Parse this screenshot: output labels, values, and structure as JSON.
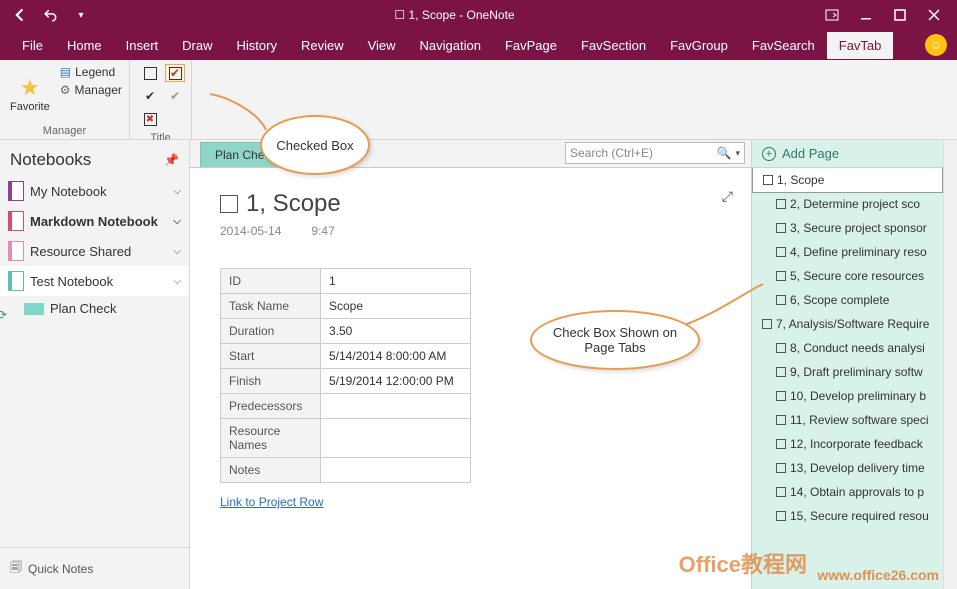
{
  "window": {
    "title": "☐ 1, Scope  -  OneNote"
  },
  "menu": {
    "items": [
      "File",
      "Home",
      "Insert",
      "Draw",
      "History",
      "Review",
      "View",
      "Navigation",
      "FavPage",
      "FavSection",
      "FavGroup",
      "FavSearch",
      "FavTab"
    ],
    "active": 12
  },
  "ribbon": {
    "favorite_label": "Favorite",
    "legend_label": "Legend",
    "manager_label": "Manager",
    "group1": "Manager",
    "group2": "Title"
  },
  "sidebar": {
    "title": "Notebooks",
    "items": [
      {
        "label": "My Notebook",
        "color": "purple"
      },
      {
        "label": "Markdown Notebook",
        "color": "red",
        "bold": true
      },
      {
        "label": "Resource Shared",
        "color": "pink"
      },
      {
        "label": "Test Notebook",
        "color": "teal",
        "selected": true
      }
    ],
    "section": "Plan Check",
    "quick": "Quick Notes"
  },
  "tabs": {
    "active": "Plan Check"
  },
  "search": {
    "placeholder": "Search (Ctrl+E)"
  },
  "page": {
    "title": "1, Scope",
    "date": "2014-05-14",
    "time": "9:47",
    "link": "Link to Project Row"
  },
  "table": [
    {
      "k": "ID",
      "v": "1"
    },
    {
      "k": "Task Name",
      "v": "Scope"
    },
    {
      "k": "Duration",
      "v": "3.50"
    },
    {
      "k": "Start",
      "v": "5/14/2014 8:00:00 AM"
    },
    {
      "k": "Finish",
      "v": "5/19/2014 12:00:00 PM"
    },
    {
      "k": "Predecessors",
      "v": ""
    },
    {
      "k": "Resource Names",
      "v": ""
    },
    {
      "k": "Notes",
      "v": ""
    }
  ],
  "addpage": "Add Page",
  "pages": [
    {
      "label": "1, Scope",
      "indent": 0,
      "sel": true
    },
    {
      "label": "2, Determine project sco",
      "indent": 1
    },
    {
      "label": "3, Secure project sponsor",
      "indent": 1
    },
    {
      "label": "4, Define preliminary reso",
      "indent": 1
    },
    {
      "label": "5, Secure core resources",
      "indent": 1
    },
    {
      "label": "6, Scope complete",
      "indent": 1
    },
    {
      "label": "7, Analysis/Software Require",
      "indent": 0
    },
    {
      "label": "8, Conduct needs analysi",
      "indent": 1
    },
    {
      "label": "9, Draft preliminary softw",
      "indent": 1
    },
    {
      "label": "10, Develop preliminary b",
      "indent": 1
    },
    {
      "label": "11, Review software speci",
      "indent": 1
    },
    {
      "label": "12, Incorporate feedback",
      "indent": 1
    },
    {
      "label": "13, Develop delivery time",
      "indent": 1
    },
    {
      "label": "14, Obtain approvals to p",
      "indent": 1
    },
    {
      "label": "15, Secure required resou",
      "indent": 1
    }
  ],
  "callouts": {
    "c1": "Checked Box",
    "c2": "Check Box Shown on Page Tabs"
  },
  "watermark": {
    "main": "Office教程网",
    "url": "www.office26.com"
  }
}
